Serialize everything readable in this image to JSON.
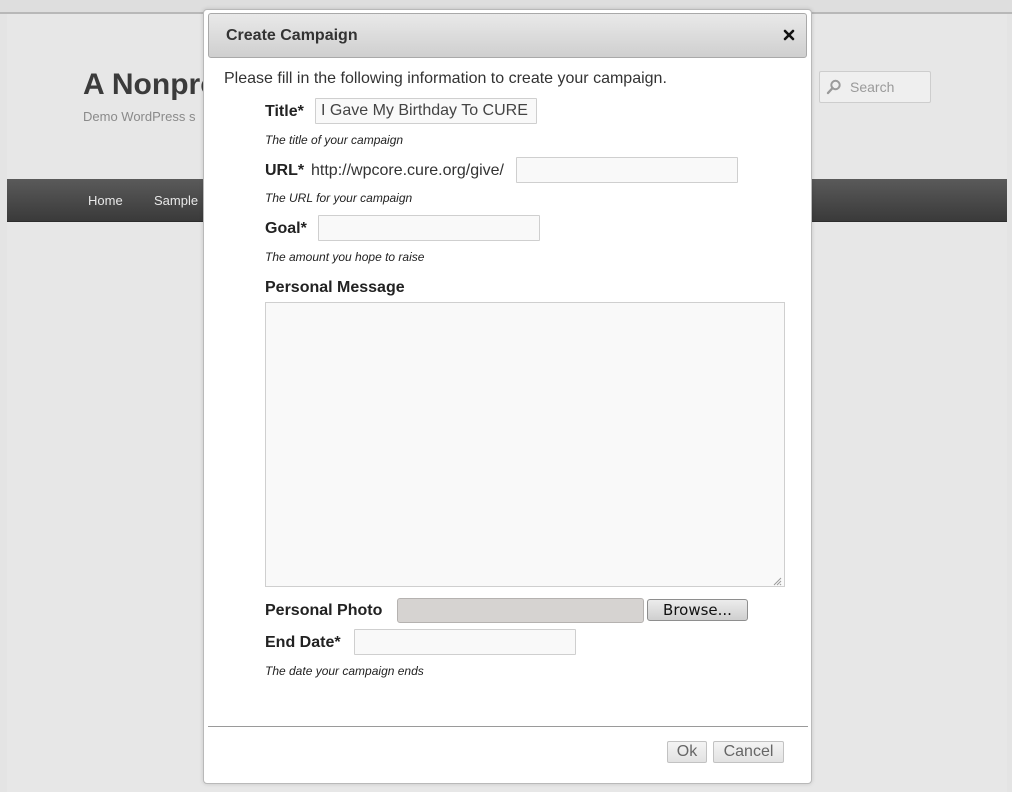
{
  "site": {
    "title": "A Nonpro",
    "description": "Demo WordPress s",
    "search_placeholder": "Search",
    "nav": [
      {
        "label": "Home"
      },
      {
        "label": "Sample"
      }
    ]
  },
  "dialog": {
    "title": "Create Campaign",
    "intro": "Please fill in the following information to create your campaign.",
    "fields": {
      "title": {
        "label": "Title*",
        "value": "I Gave My Birthday To CURE",
        "hint": "The title of your campaign"
      },
      "url": {
        "label": "URL*",
        "prefix": "http://wpcore.cure.org/give/",
        "value": "",
        "hint": "The URL for your campaign"
      },
      "goal": {
        "label": "Goal*",
        "value": "",
        "hint": "The amount you hope to raise"
      },
      "message": {
        "label": "Personal Message",
        "value": ""
      },
      "photo": {
        "label": "Personal Photo",
        "browse_label": "Browse..."
      },
      "end_date": {
        "label": "End Date*",
        "value": "",
        "hint": "The date your campaign ends"
      }
    },
    "buttons": {
      "ok": "Ok",
      "cancel": "Cancel"
    }
  },
  "icons": {
    "close": "close-icon",
    "search": "search-icon"
  }
}
